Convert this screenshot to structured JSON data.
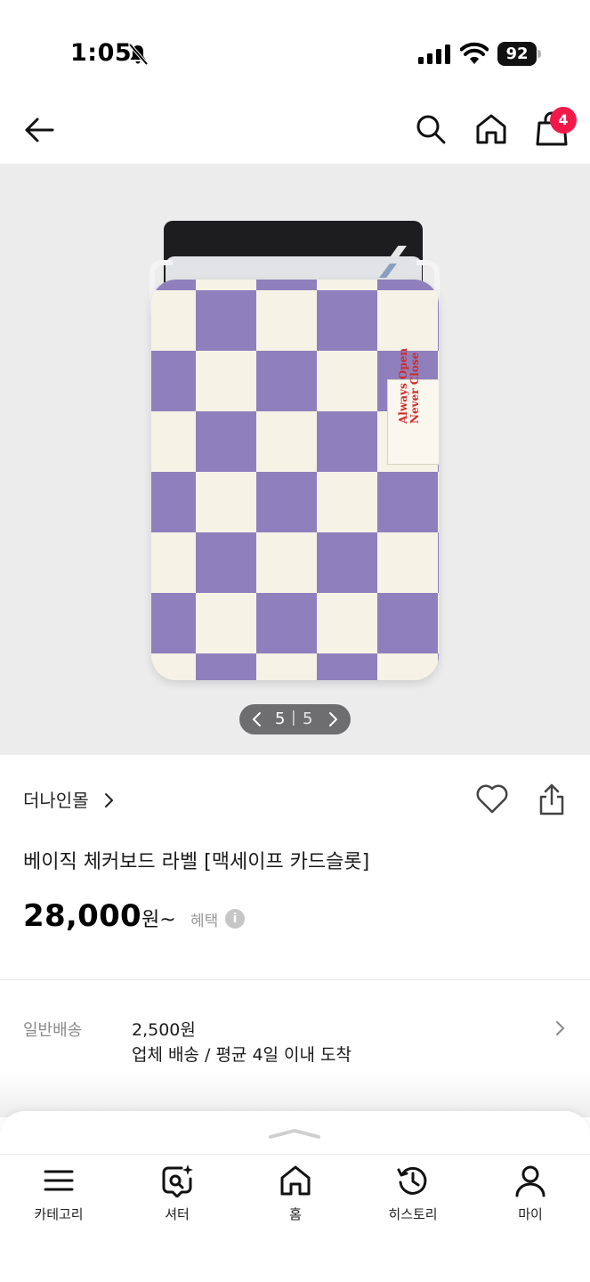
{
  "status_bar": {
    "time": "1:05",
    "battery": "92"
  },
  "header": {
    "cart_count": "4"
  },
  "product_image": {
    "current": "5",
    "separator": "|",
    "total": "5",
    "label_text_line1": "Always Open",
    "label_text_line2": "Never Close"
  },
  "product": {
    "brand": "더나인몰",
    "title": "베이직 체커보드 라벨 [맥세이프 카드슬롯]",
    "price": "28,000",
    "price_unit": "원~",
    "benefit_label": "혜택",
    "info_icon": "i"
  },
  "shipping": {
    "label": "일반배송",
    "price": "2,500원",
    "description": "업체 배송 / 평균 4일 이내 도착"
  },
  "bottom_nav": {
    "items": [
      {
        "label": "카테고리",
        "icon": "menu-icon"
      },
      {
        "label": "셔터",
        "icon": "shutter-icon"
      },
      {
        "label": "홈",
        "icon": "home-icon"
      },
      {
        "label": "히스토리",
        "icon": "history-icon"
      },
      {
        "label": "마이",
        "icon": "person-icon"
      }
    ]
  },
  "colors": {
    "badge": "#f2194a",
    "checker_purple": "#8f80bd",
    "checker_cream": "#f6f2e6",
    "image_bg": "#ececed"
  }
}
